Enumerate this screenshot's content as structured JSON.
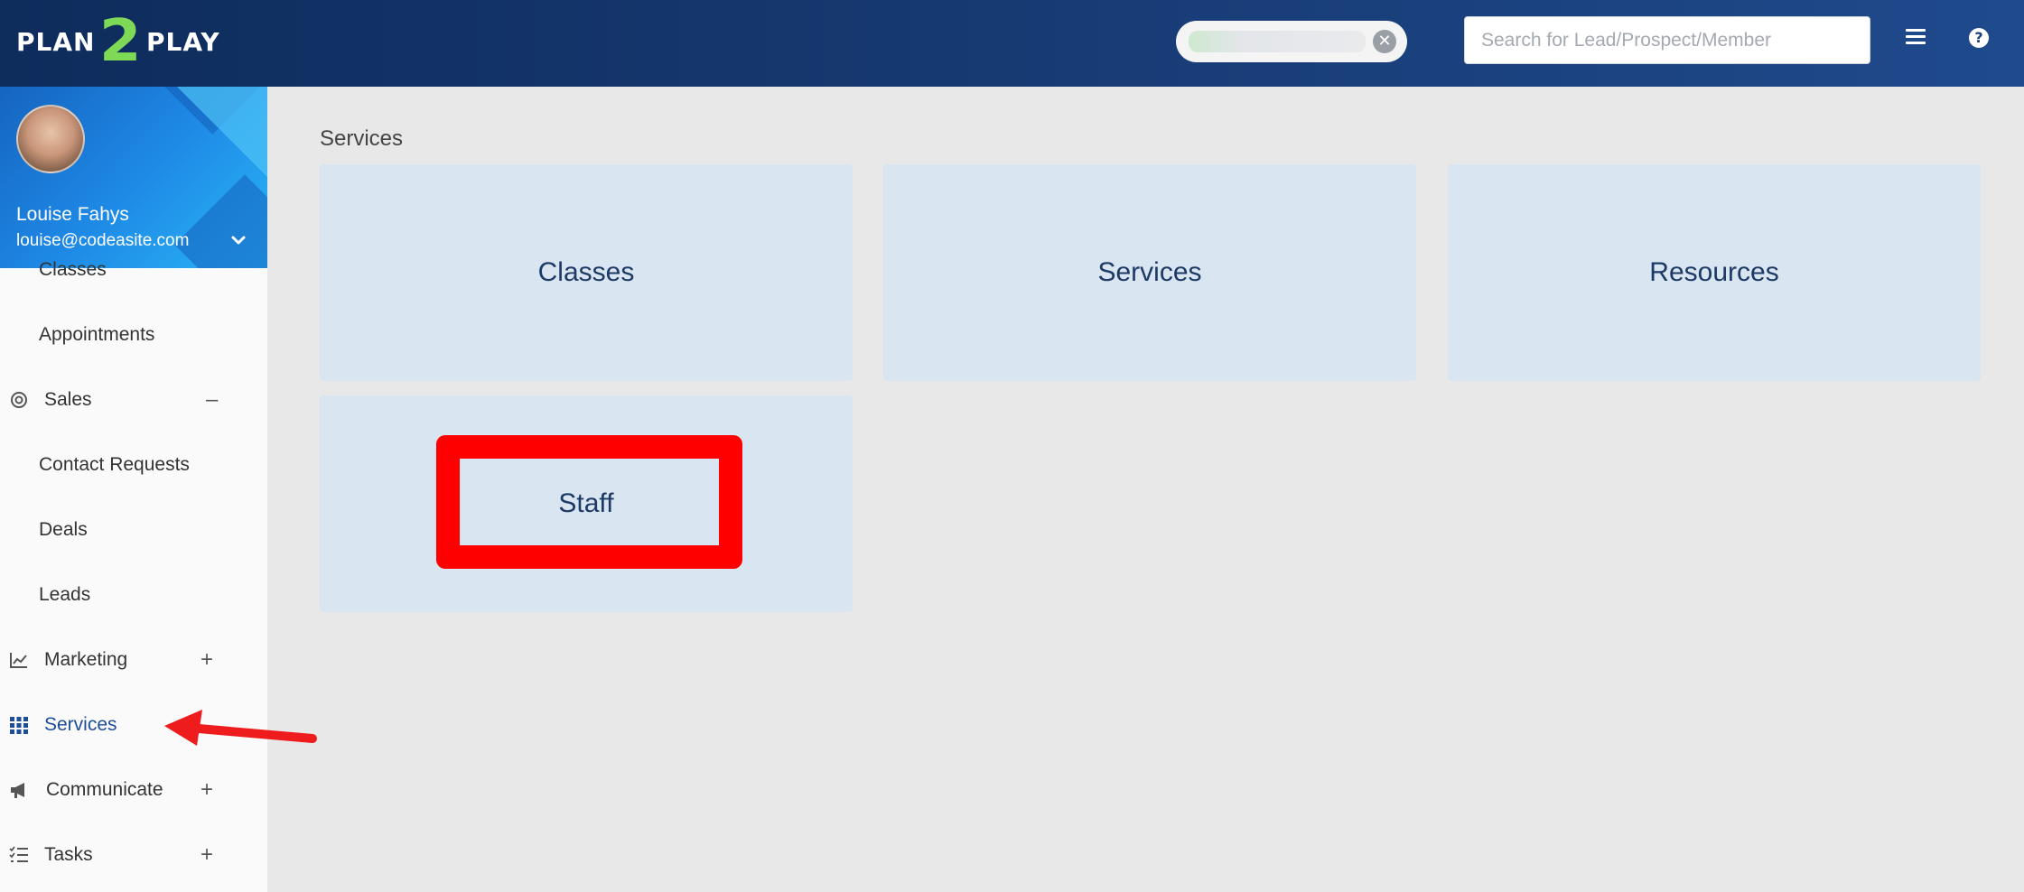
{
  "brand": {
    "left": "PLAN",
    "mid": "2",
    "right": "PLAY"
  },
  "header": {
    "search_placeholder": "Search for Lead/Prospect/Member",
    "close_symbol": "✕",
    "help_symbol": "?"
  },
  "user": {
    "name": "Louise Fahys",
    "email": "louise@codeasite.com"
  },
  "sidebar": {
    "items": [
      {
        "label": "Classes",
        "icon": ""
      },
      {
        "label": "Appointments",
        "icon": ""
      },
      {
        "label": "Sales",
        "icon": "target-icon",
        "toggle": "–"
      },
      {
        "label": "Contact Requests",
        "icon": ""
      },
      {
        "label": "Deals",
        "icon": ""
      },
      {
        "label": "Leads",
        "icon": ""
      },
      {
        "label": "Marketing",
        "icon": "chart-icon",
        "toggle": "+"
      },
      {
        "label": "Services",
        "icon": "grid-icon",
        "active": true
      },
      {
        "label": "Communicate",
        "icon": "megaphone-icon",
        "toggle": "+"
      },
      {
        "label": "Tasks",
        "icon": "checklist-icon",
        "toggle": "+"
      }
    ]
  },
  "main": {
    "breadcrumb": "Services",
    "tiles": [
      {
        "label": "Classes"
      },
      {
        "label": "Services"
      },
      {
        "label": "Resources"
      },
      {
        "label": "Staff"
      }
    ]
  },
  "colors": {
    "header_start": "#0e2c5c",
    "header_end": "#1f4a8c",
    "tile_bg": "#d9e5f0",
    "tile_text": "#1d3a66",
    "active_nav": "#1c4e9a",
    "annotation_red": "#ff0000",
    "logo_green": "#7ed957"
  }
}
